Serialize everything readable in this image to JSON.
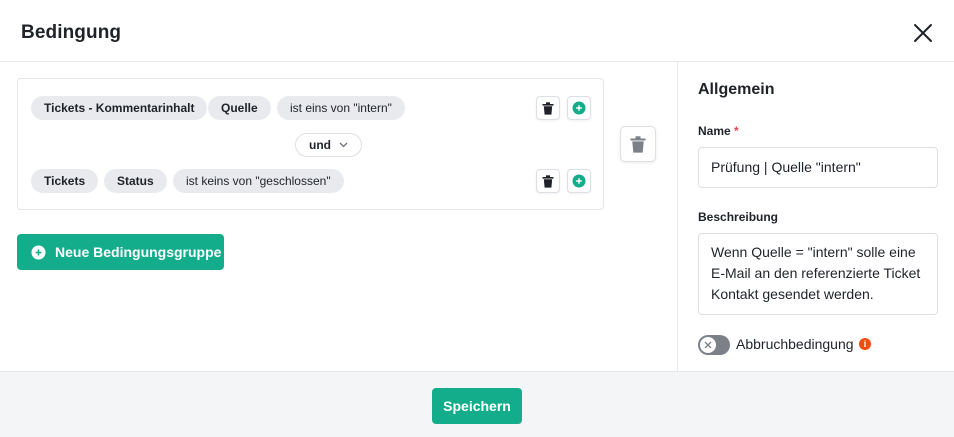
{
  "dialog": {
    "title": "Bedingung"
  },
  "conditions": {
    "rows": [
      {
        "object": "Tickets - Kommentarinhalt",
        "field": "Quelle",
        "operator_value": "ist eins von \"intern\""
      },
      {
        "object": "Tickets",
        "field": "Status",
        "operator_value": "ist keins von \"geschlossen\""
      }
    ],
    "connector": "und",
    "new_group_label": "Neue Bedingungsgruppe"
  },
  "sidebar": {
    "title": "Allgemein",
    "name_label": "Name",
    "name_required_mark": "*",
    "name_value": "Prüfung | Quelle \"intern\"",
    "description_label": "Beschreibung",
    "description_value": "Wenn Quelle = \"intern\" solle eine E-Mail an den referenzierte Ticket Kontakt gesendet werden.",
    "abort_toggle_label": "Abbruchbedingung",
    "abort_toggle_on": false,
    "info_icon_glyph": "i"
  },
  "footer": {
    "save_label": "Speichern"
  },
  "colors": {
    "accent": "#14ad8c",
    "chip_bg": "#e8eaed",
    "info": "#f04e0d",
    "required": "#e5484d"
  },
  "icons": {
    "close": "close-icon",
    "delete": "trash-icon",
    "add": "plus-circle-icon",
    "chevron": "chevron-down-icon",
    "toggle_off": "x-icon",
    "info": "info-icon"
  }
}
